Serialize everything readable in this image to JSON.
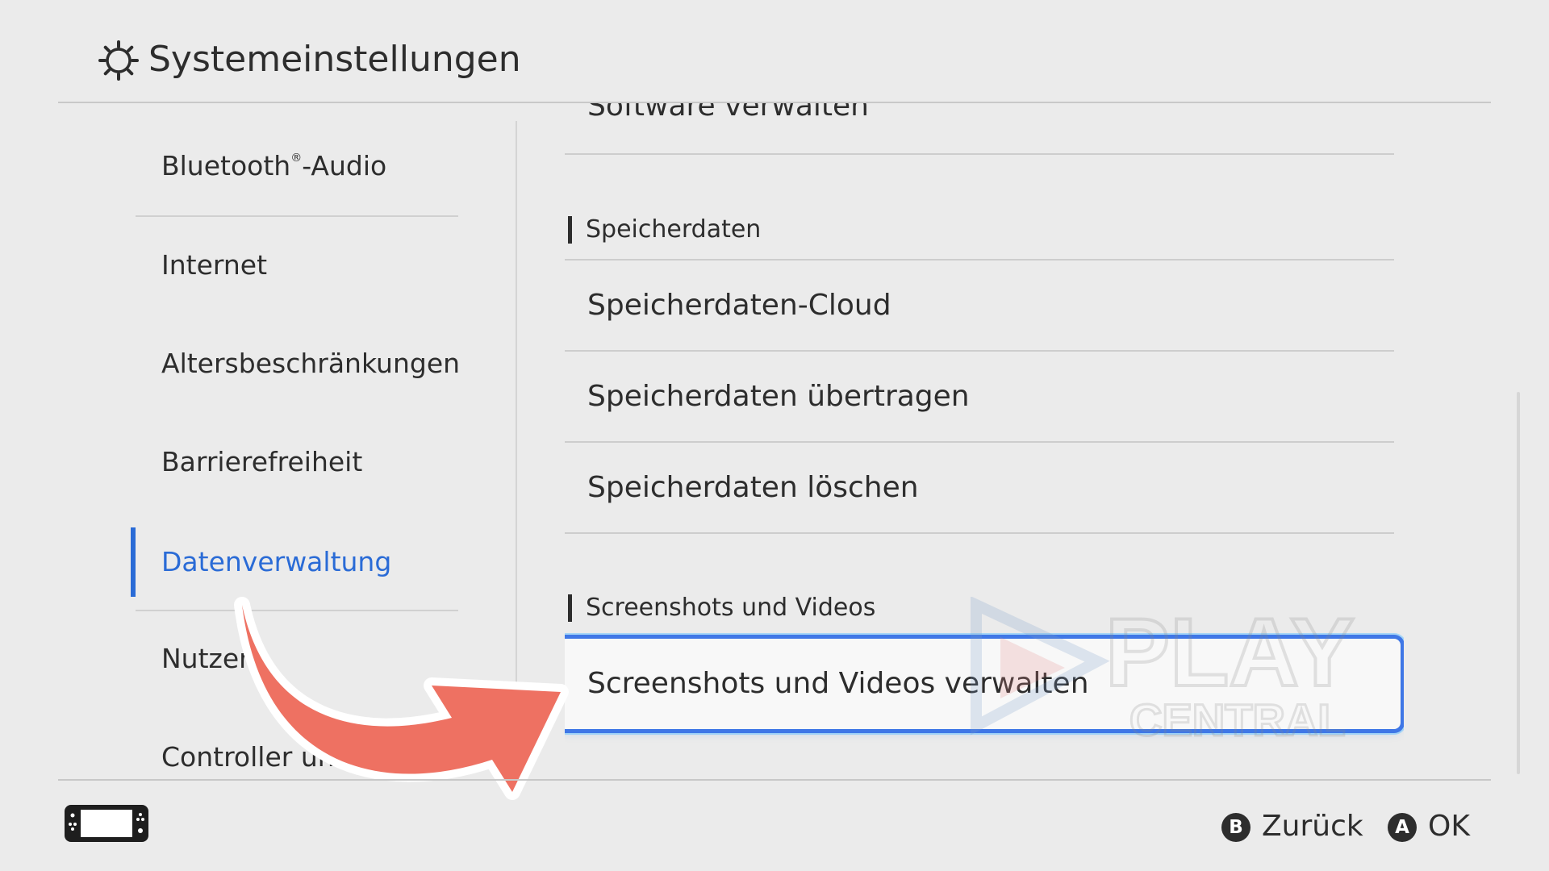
{
  "header": {
    "title": "Systemeinstellungen",
    "icon": "gear-icon"
  },
  "sidebar": {
    "items": [
      {
        "pre": "Bluetooth",
        "sup": "®",
        "post": "-Audio"
      },
      {
        "label": "Internet"
      },
      {
        "label": "Altersbeschränkungen"
      },
      {
        "label": "Barrierefreiheit"
      },
      {
        "label": "Datenverwaltung",
        "active": true
      },
      {
        "label": "Nutzer"
      },
      {
        "label": "Controller und Zubehör"
      }
    ]
  },
  "content": {
    "top_row": "Software verwalten",
    "section_save": "Speicherdaten",
    "save_rows": [
      "Speicherdaten-Cloud",
      "Speicherdaten übertragen",
      "Speicherdaten löschen"
    ],
    "section_media": "Screenshots und Videos",
    "media_rows": [
      "Screenshots und Videos verwalten"
    ]
  },
  "footer": {
    "back_badge": "B",
    "back_label": "Zurück",
    "ok_badge": "A",
    "ok_label": "OK"
  },
  "overlay": {
    "watermark_line1": "PLAY",
    "watermark_line2": "CENTRAL",
    "arrow_color": "#ee7162"
  },
  "colors": {
    "accent": "#2a6bd6",
    "background": "#ebebeb",
    "text": "#2d2d2d"
  }
}
